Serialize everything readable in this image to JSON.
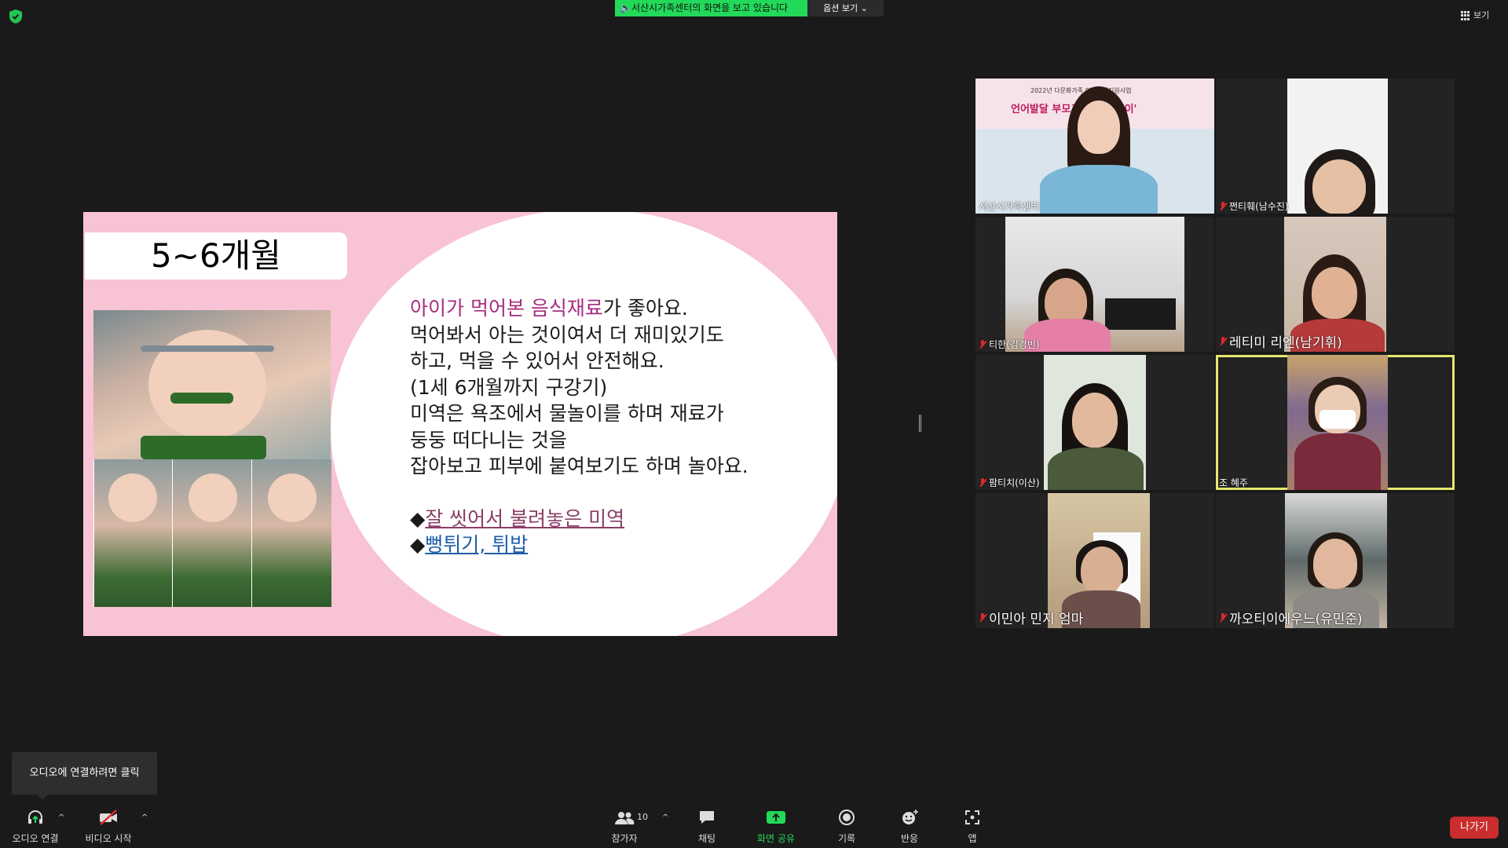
{
  "top": {
    "share_banner": "서산시가족센터의 화면을 보고 있습니다",
    "view_options": "옵션 보기",
    "view_button": "보기"
  },
  "slide": {
    "title": "5~6개월",
    "highlight": "아이가 먹어본 음식재료",
    "line1_rest": "가 좋아요.",
    "line2": "먹어봐서 아는 것이여서 더 재미있기도",
    "line3": "하고, 먹을 수 있어서 안전해요.",
    "line4": "(1세 6개월까지 구강기)",
    "line5": "미역은 욕조에서 물놀이를 하며 재료가",
    "line6": "둥둥 떠다니는 것을",
    "line7": "잡아보고 피부에 붙여보기도 하며 놀아요.",
    "bullet1": "잘 씻어서 불려놓은 미역",
    "bullet2": "뻥튀기, 튀밥",
    "bullet_mark": "◆"
  },
  "participants": [
    {
      "name": "서산시가족센터",
      "muted": false,
      "banner_line1": "2022년 다문화가족 언어발달지원사업",
      "banner_line2": "언어발달 부모교육 '길라잡이'"
    },
    {
      "name": "쩐티훼(남수진)",
      "muted": true
    },
    {
      "name": "티한(김경빈)",
      "muted": true
    },
    {
      "name": "레티미 리엔(남기휘)",
      "muted": true
    },
    {
      "name": "팜티치(이산)",
      "muted": true
    },
    {
      "name": "조 혜주",
      "muted": false,
      "active": true
    },
    {
      "name": "이민아 민지 엄마",
      "muted": true
    },
    {
      "name": "까오티이에우느(유민준)",
      "muted": true
    }
  ],
  "tooltip": "오디오에 연결하려면 클릭",
  "toolbar": {
    "audio": "오디오 연결",
    "video": "비디오 시작",
    "participants": "참가자",
    "participants_count": "10",
    "chat": "채팅",
    "share": "화면 공유",
    "record": "기록",
    "reactions": "반응",
    "apps": "앱",
    "leave": "나가기"
  },
  "colors": {
    "background": "#1a1a1a",
    "share_green": "#23d959",
    "leave_red": "#c92d2d",
    "active_speaker": "#e6e66e",
    "slide_pink": "#f8c3d4",
    "highlight_purple": "#a62d7e"
  }
}
